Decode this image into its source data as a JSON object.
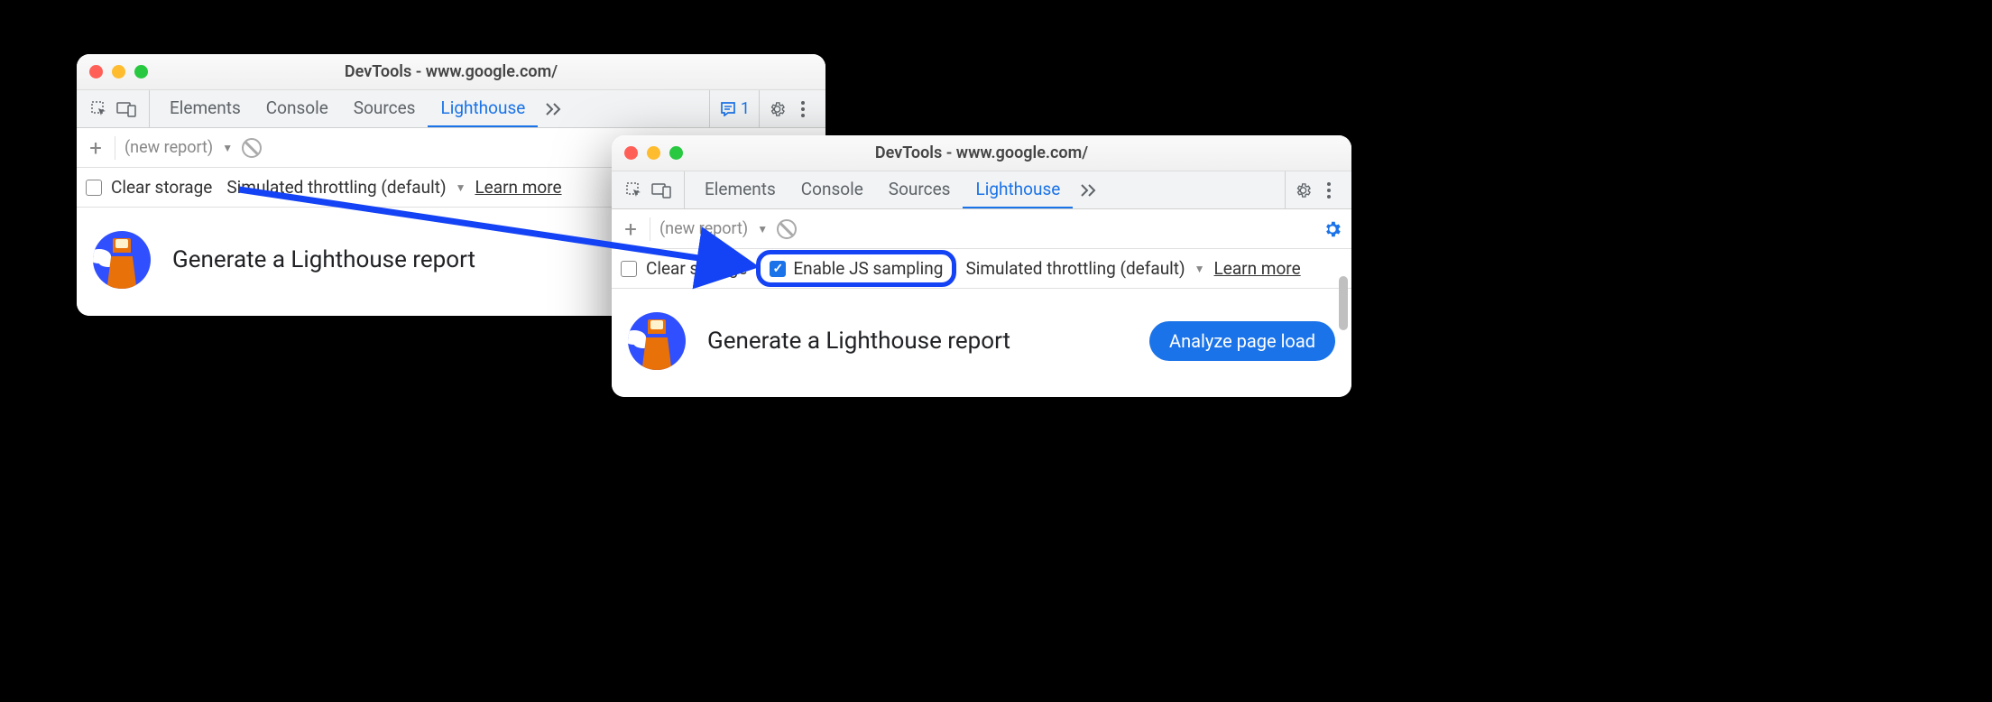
{
  "arrow_color": "#1442f5",
  "windows": {
    "w1": {
      "title": "DevTools - www.google.com/",
      "tabs": [
        "Elements",
        "Console",
        "Sources",
        "Lighthouse"
      ],
      "active_tab_index": 3,
      "issues_count": "1",
      "new_report_label": "(new report)",
      "options": {
        "clear_storage": "Clear storage",
        "throttling": "Simulated throttling (default)",
        "learn_more": "Learn more"
      },
      "main_title": "Generate a Lighthouse report"
    },
    "w2": {
      "title": "DevTools - www.google.com/",
      "tabs": [
        "Elements",
        "Console",
        "Sources",
        "Lighthouse"
      ],
      "active_tab_index": 3,
      "new_report_label": "(new report)",
      "options": {
        "clear_storage": "Clear storage",
        "enable_js_sampling": "Enable JS sampling",
        "throttling": "Simulated throttling (default)",
        "learn_more": "Learn more"
      },
      "main_title": "Generate a Lighthouse report",
      "analyze_label": "Analyze page load"
    }
  }
}
